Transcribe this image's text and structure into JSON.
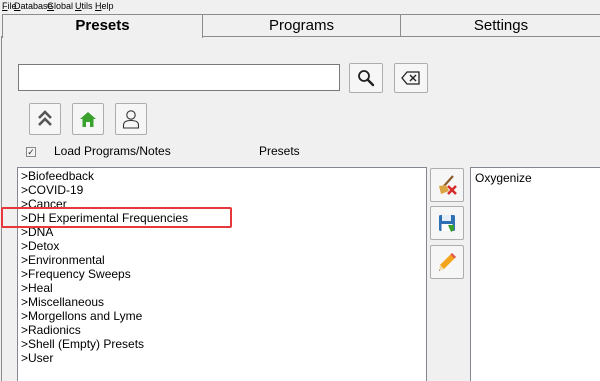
{
  "menu": [
    "File",
    "Database",
    "Global",
    "Utils",
    "Help"
  ],
  "tabs": [
    "Presets",
    "Programs",
    "Settings"
  ],
  "search": {
    "value": "",
    "placeholder": ""
  },
  "toolbar": {
    "search_icon": "magnifier-icon",
    "clear_icon": "backspace-clear-icon",
    "collapse_icon": "double-chevron-up-icon",
    "home_icon": "home-icon",
    "user_icon": "person-icon"
  },
  "options": {
    "load_programs_label": "Load Programs/Notes",
    "load_programs_checked": true
  },
  "presets_heading": "Presets",
  "preset_items": [
    ">Biofeedback",
    ">COVID-19",
    ">Cancer",
    ">DH Experimental Frequencies",
    ">DNA",
    ">Detox",
    ">Environmental",
    ">Frequency Sweeps",
    ">Heal",
    ">Miscellaneous",
    ">Morgellons and Lyme",
    ">Radionics",
    ">Shell (Empty) Presets",
    ">User"
  ],
  "highlighted_item": ">DH Experimental Frequencies",
  "side_actions": {
    "delete_icon": "broom-delete-icon",
    "save_icon": "save-disk-icon",
    "edit_icon": "pencil-icon"
  },
  "program_items": [
    "Oxygenize"
  ],
  "colors": {
    "highlight_border": "#e8373a",
    "home_green": "#3aa12c",
    "collapse_gray": "#555555"
  }
}
